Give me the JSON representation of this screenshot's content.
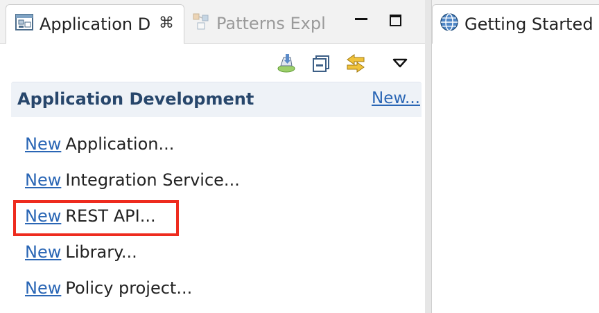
{
  "left_view": {
    "tabs": [
      {
        "label": "Application D",
        "active": true,
        "icon": "app-dev-icon",
        "close": "⌘"
      },
      {
        "label": "Patterns Expl",
        "active": false,
        "icon": "patterns-icon"
      }
    ]
  },
  "section": {
    "title": "Application Development",
    "header_link": "New...",
    "links": [
      {
        "link": "New",
        "text": "Application..."
      },
      {
        "link": "New",
        "text": "Integration Service..."
      },
      {
        "link": "New",
        "text": "REST API..."
      },
      {
        "link": "New",
        "text": "Library..."
      },
      {
        "link": "New",
        "text": "Policy project..."
      }
    ]
  },
  "toolbar": {
    "icons": [
      "deploy-icon",
      "collapse-all-icon",
      "sync-icon",
      "view-menu-icon"
    ]
  },
  "right_editor": {
    "tab_label": "Getting Started - I",
    "tab_icon": "globe-icon"
  },
  "colors": {
    "link": "#2a66b5",
    "header_text": "#27466b",
    "highlight": "#ee2b1e"
  }
}
